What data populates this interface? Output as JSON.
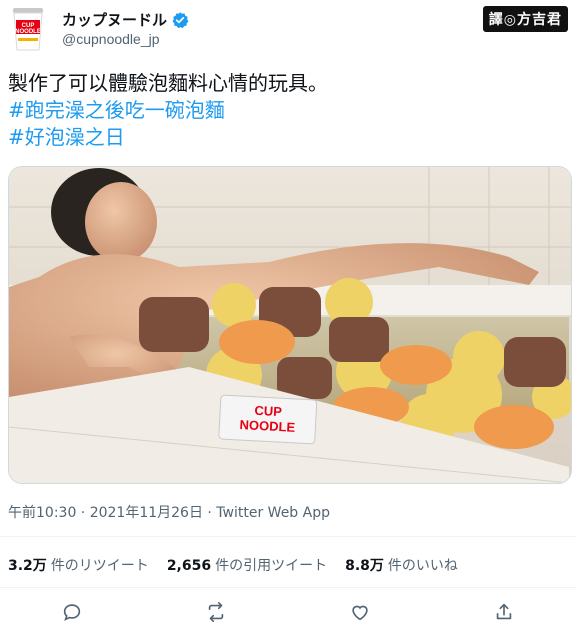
{
  "author": {
    "display_name": "カップヌードル",
    "handle": "@cupnoodle_jp",
    "avatar_icon": "cup-noodle-logo-icon",
    "verified_icon": "verified-badge-icon"
  },
  "watermark": "譯◎方吉君",
  "tweet": {
    "line1": "製作了可以體驗泡麵料心情的玩具。",
    "hashtag1": "#跑完澡之後吃一碗泡麵",
    "hashtag2": "#好泡澡之日"
  },
  "media": {
    "logo_text_1": "CUP",
    "logo_text_2": "NOODLE"
  },
  "meta": "午前10:30 · 2021年11月26日 · Twitter Web App",
  "stats": [
    {
      "count": "3.2万",
      "label": "件のリツイート"
    },
    {
      "count": "2,656",
      "label": "件の引用ツイート"
    },
    {
      "count": "8.8万",
      "label": "件のいいね"
    }
  ],
  "actions": [
    "reply-icon",
    "retweet-icon",
    "like-icon",
    "share-icon"
  ],
  "colors": {
    "accent": "#1d9bf0",
    "verified": "#1d9bf0",
    "muted": "#536471"
  }
}
